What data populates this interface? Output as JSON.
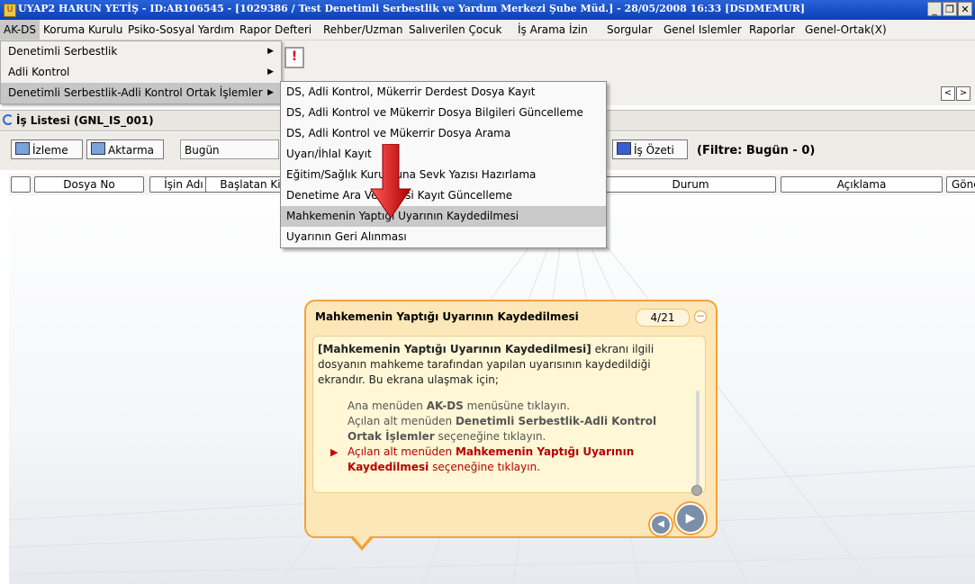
{
  "window": {
    "title": "UYAP2 HARUN YETİŞ - ID:AB106545 - [1029386 / Test Denetimli Serbestlik ve Yardım Merkezi Şube Müd.] - 28/05/2008 16:33 [DSDMEMUR]",
    "minimize": "_",
    "restore": "❐",
    "close": "✕"
  },
  "menubar": {
    "items": [
      "AK-DS",
      "Koruma Kurulu",
      "Psiko-Sosyal Yardım",
      "Rapor Defteri",
      "Rehber/Uzman",
      "Salıverilen Çocuk",
      "İş Arama İzin",
      "Sorgular",
      "Genel Islemler",
      "Raporlar",
      "Genel-Ortak(X)"
    ]
  },
  "menu_akds": {
    "items": [
      {
        "label": "Denetimli Serbestlik",
        "arrow": "▶"
      },
      {
        "label": "Adli Kontrol",
        "arrow": "▶"
      },
      {
        "label": "Denetimli Serbestlik-Adli Kontrol Ortak İşlemler",
        "arrow": "▶"
      }
    ]
  },
  "submenu": {
    "items": [
      "DS, Adli Kontrol, Mükerrir Derdest Dosya Kayıt",
      "DS, Adli Kontrol ve Mükerrir Dosya Bilgileri Güncelleme",
      "DS, Adli Kontrol ve Mükerrir Dosya Arama",
      "Uyarı/İhlal Kayıt",
      "Eğitim/Sağlık Kurumuna Sevk Yazısı Hazırlama",
      "Denetime Ara Verilmesi Kayıt Güncelleme",
      "Mahkemenin Yaptığı Uyarının Kaydedilmesi",
      "Uyarının Geri Alınması"
    ],
    "selected_index": 6
  },
  "toolbar": {
    "alarm_icon": "!",
    "nav_prev": "<",
    "nav_next": ">"
  },
  "worklist": {
    "title": "İş Listesi (GNL_IS_001)",
    "buttons": {
      "izleme": "İzleme",
      "aktarma": "Aktarma",
      "bugun": "Bugün",
      "is_ozeti": "İş Özeti"
    },
    "filter": "(Filtre: Bugün - 0)",
    "columns": [
      "Dosya No",
      "İşin Adı",
      "Başlatan Ki",
      "Durum",
      "Açıklama",
      "Gönderen Bi"
    ]
  },
  "tooltip": {
    "title": "Mahkemenin Yaptığı Uyarının Kaydedilmesi",
    "counter": "4/21",
    "min_icon": "−",
    "bold_intro": "[Mahkemenin Yaptığı Uyarının Kaydedilmesi]",
    "intro_rest": " ekranı ilgili dosyanın mahkeme tarafından yapılan uyarısının kaydedildiği ekrandır. Bu ekrana ulaşmak için;",
    "step1_a": "Ana menüden ",
    "step1_b": "AK-DS",
    "step1_c": " menüsüne tıklayın.",
    "step2_a": "Açılan alt menüden ",
    "step2_b": "Denetimli Serbestlik-Adli Kontrol Ortak İşlemler",
    "step2_c": " seçeneğine tıklayın.",
    "step3_marker": "▶",
    "step3_a": "Açılan alt menüden ",
    "step3_b": "Mahkemenin Yaptığı Uyarının Kaydedilmesi",
    "step3_c": " seçeneğine tıklayın.",
    "prev": "◀",
    "next": "▶"
  },
  "colors": {
    "title_bar": "#0a3fb8",
    "balloon_border": "#f2a23a",
    "balloon_fill": "#fce7b8",
    "highlight_text": "#b80000",
    "pointer_arrow": "#d01818"
  }
}
